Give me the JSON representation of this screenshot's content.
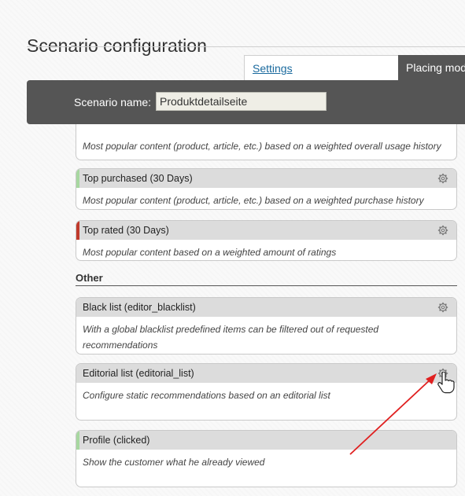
{
  "page": {
    "title": "Scenario configuration"
  },
  "tabs": [
    {
      "label": "Settings"
    },
    {
      "label": "Placing mod"
    }
  ],
  "scenario": {
    "label": "Scenario name:",
    "value": "Produktdetailseite"
  },
  "cards_top": [
    {
      "title": "",
      "description": "Most popular content (product, article, etc.) based on a weighted overall usage history"
    },
    {
      "title": "Top purchased (30 Days)",
      "description": "Most popular content (product, article, etc.) based on a weighted purchase history",
      "stripe": "#a7d7a0"
    },
    {
      "title": "Top rated (30 Days)",
      "description": "Most popular content based on a weighted amount of ratings",
      "stripe": "#c0392b"
    }
  ],
  "section": {
    "heading": "Other"
  },
  "cards_other": [
    {
      "title": "Black list (editor_blacklist)",
      "description": "With a global blacklist predefined items can be filtered out of requested recommendations"
    },
    {
      "title": "Editorial list (editorial_list)",
      "description": "Configure static recommendations based on an editorial list"
    },
    {
      "title": "Profile (clicked)",
      "description": "Show the customer what he already viewed",
      "stripe": "#a7d7a0"
    }
  ],
  "icons": {
    "gear": "gear-icon",
    "pointer": "hand-pointer-icon",
    "arrow": "red-arrow-annotation"
  }
}
